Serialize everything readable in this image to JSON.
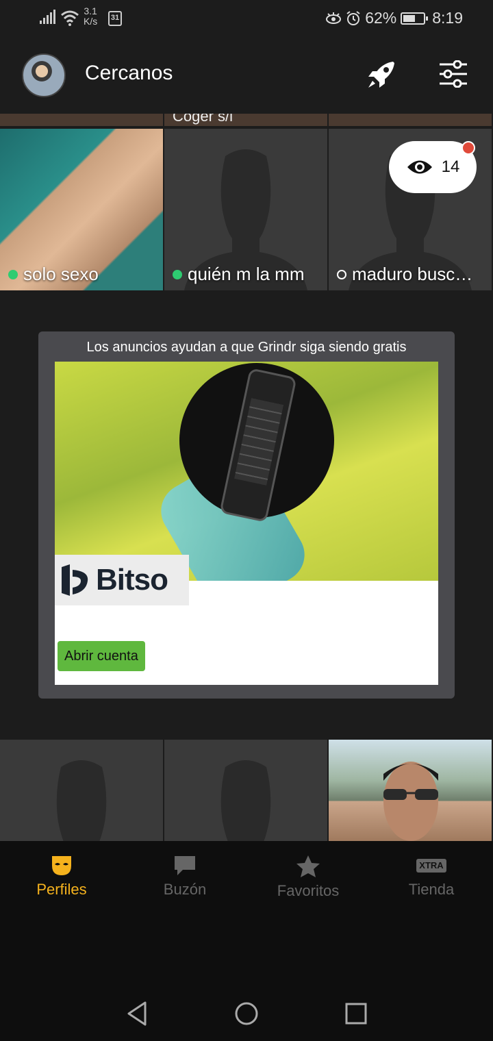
{
  "status_bar": {
    "net_speed_value": "3.1",
    "net_speed_unit": "K/s",
    "calendar_day": "31",
    "battery": "62%",
    "battery_level": 0.62,
    "time": "8:19"
  },
  "header": {
    "title": "Cercanos"
  },
  "grid": {
    "partial_row": [
      "",
      "Coger s/l",
      ""
    ],
    "row1": [
      {
        "name": "solo sexo",
        "online": true
      },
      {
        "name": "quién m la mm",
        "online": true
      },
      {
        "name": "maduro busc…",
        "online": false
      }
    ],
    "row3": [
      {
        "name": ""
      },
      {
        "name": ""
      },
      {
        "name": ""
      }
    ]
  },
  "viewed_me": {
    "count": "14",
    "icon": "eye-icon"
  },
  "ad": {
    "note": "Los anuncios ayudan a que Grindr siga siendo gratis",
    "brand": "Bitso",
    "cta": "Abrir cuenta"
  },
  "bottom_nav": {
    "items": [
      {
        "label": "Perfiles",
        "icon": "mask-icon",
        "active": true
      },
      {
        "label": "Buzón",
        "icon": "chat-icon",
        "active": false
      },
      {
        "label": "Favoritos",
        "icon": "star-icon",
        "active": false
      },
      {
        "label": "Tienda",
        "icon": "xtra-icon",
        "badge": "XTRA",
        "active": false
      }
    ]
  },
  "colors": {
    "accent": "#f5b21d",
    "online": "#2ecc71",
    "cta_green": "#5fb83e",
    "badge_red": "#e04a3a"
  }
}
